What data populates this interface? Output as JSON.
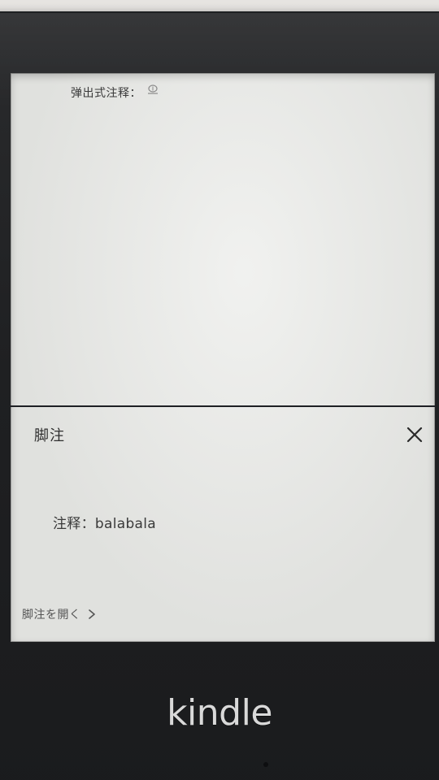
{
  "device": {
    "logo_text": "kindle"
  },
  "book": {
    "text": "弹出式注释："
  },
  "footnote_panel": {
    "title": "脚注",
    "body": "注释：balabala",
    "open_link": "脚注を開く"
  },
  "icons": {
    "close": "close-icon",
    "chevron": "chevron-right-icon",
    "note_marker": "footnote-marker-icon"
  }
}
